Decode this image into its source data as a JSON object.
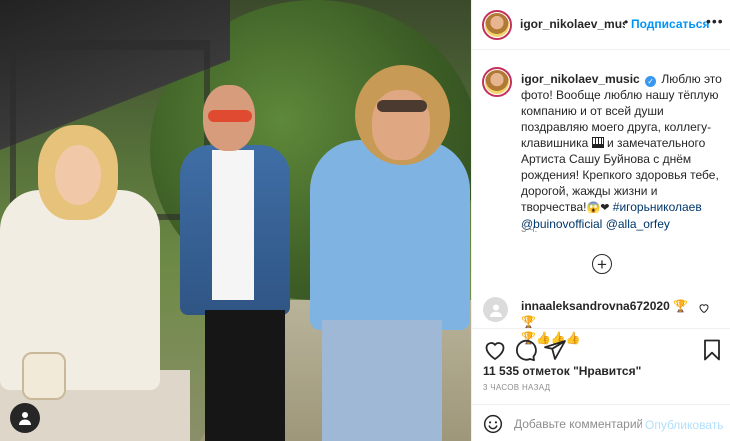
{
  "post": {
    "username": "igor_nikolaev_musi",
    "follow_label": "Подписаться",
    "dot": "•",
    "more": "•••"
  },
  "caption": {
    "username": "igor_nikolaev_music",
    "text1": " Люблю это фото! Вообще люблю нашу тёплую компанию и от всей души поздравляю моего друга, коллегу-клавишника ",
    "text2": " и замечательного Артиста Сашу Буйнова с днём рождения! Крепкого здоровья тебе, дорогой, жажды жизни и творчества!",
    "emoji": "😱❤",
    "hashtag": "#игорьниколаев",
    "mention1": "@buinovofficial",
    "mention2": "@alla_orfey",
    "time": "3 ч.",
    "verified": "✓"
  },
  "comment": {
    "username": "innaaleksandrovna672020",
    "emoji1": " 🏆🏆",
    "emoji2": "🏆👍👍👍"
  },
  "likes": "11 535 отметок \"Нравится\"",
  "time_ago": "3 ЧАСОВ НАЗАД",
  "add_comment": {
    "placeholder": "Добавьте комментарий...",
    "publish": "Опубликовать"
  },
  "plus": "+",
  "icons": [
    "heart-icon",
    "comment-icon",
    "share-icon",
    "bookmark-icon",
    "smile-icon",
    "user-icon",
    "plus-circle-icon",
    "verified-icon"
  ],
  "colors": {
    "accent": "#0095f6",
    "publish_disabled": "#b2dffc",
    "muted": "#8e8e8e",
    "verified": "#3897f0"
  }
}
